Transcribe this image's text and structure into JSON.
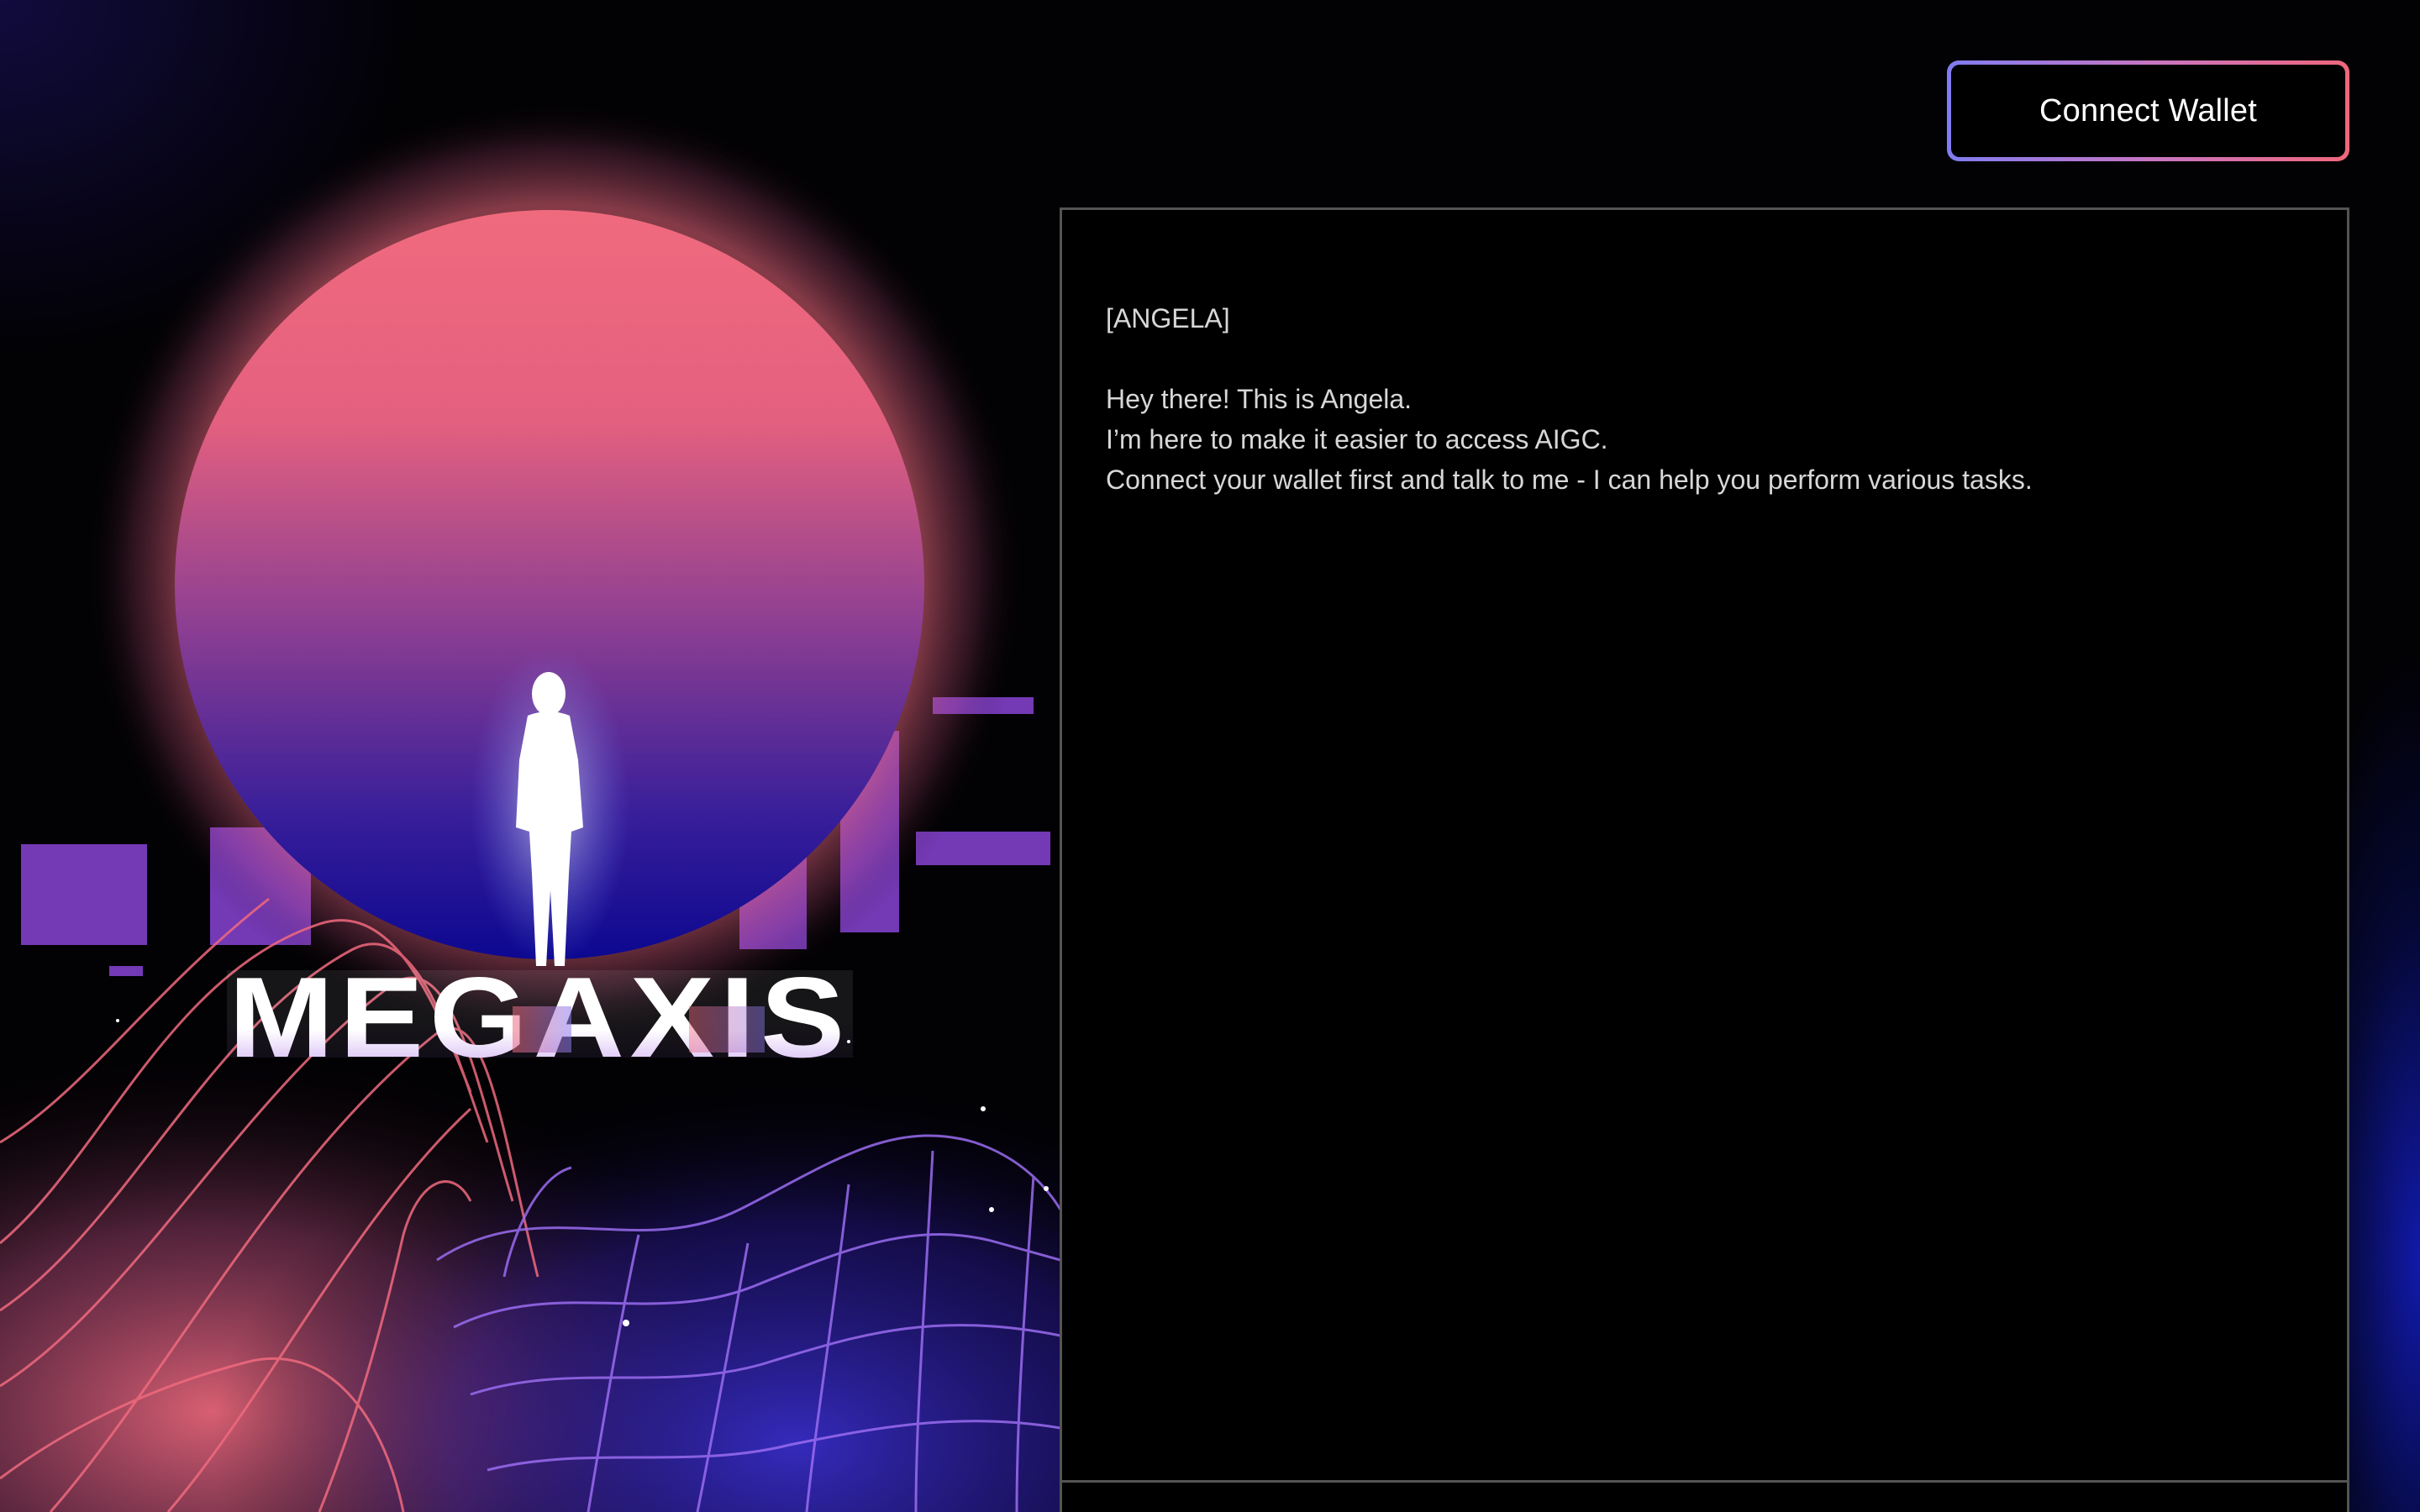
{
  "header": {
    "connect_wallet_label": "Connect Wallet"
  },
  "hero": {
    "logo_text": "MEGAXIS",
    "colors": {
      "sun_top": "#f06a7e",
      "sun_bottom": "#0c0890",
      "grid_warm": "#f06a7e",
      "grid_cool": "#9a6cf0"
    }
  },
  "chat": {
    "speaker": "[ANGELA]",
    "messages": [
      "Hey there! This is Angela.",
      "I’m here to make it easier to access AIGC.",
      "Connect your wallet first and talk to me - I can help you perform various tasks."
    ]
  },
  "colors": {
    "background": "#000000",
    "panel_border": "#545454",
    "text": "#d7d7d7",
    "button_gradient_start": "#7f7cf0",
    "button_gradient_end": "#f0677b"
  }
}
